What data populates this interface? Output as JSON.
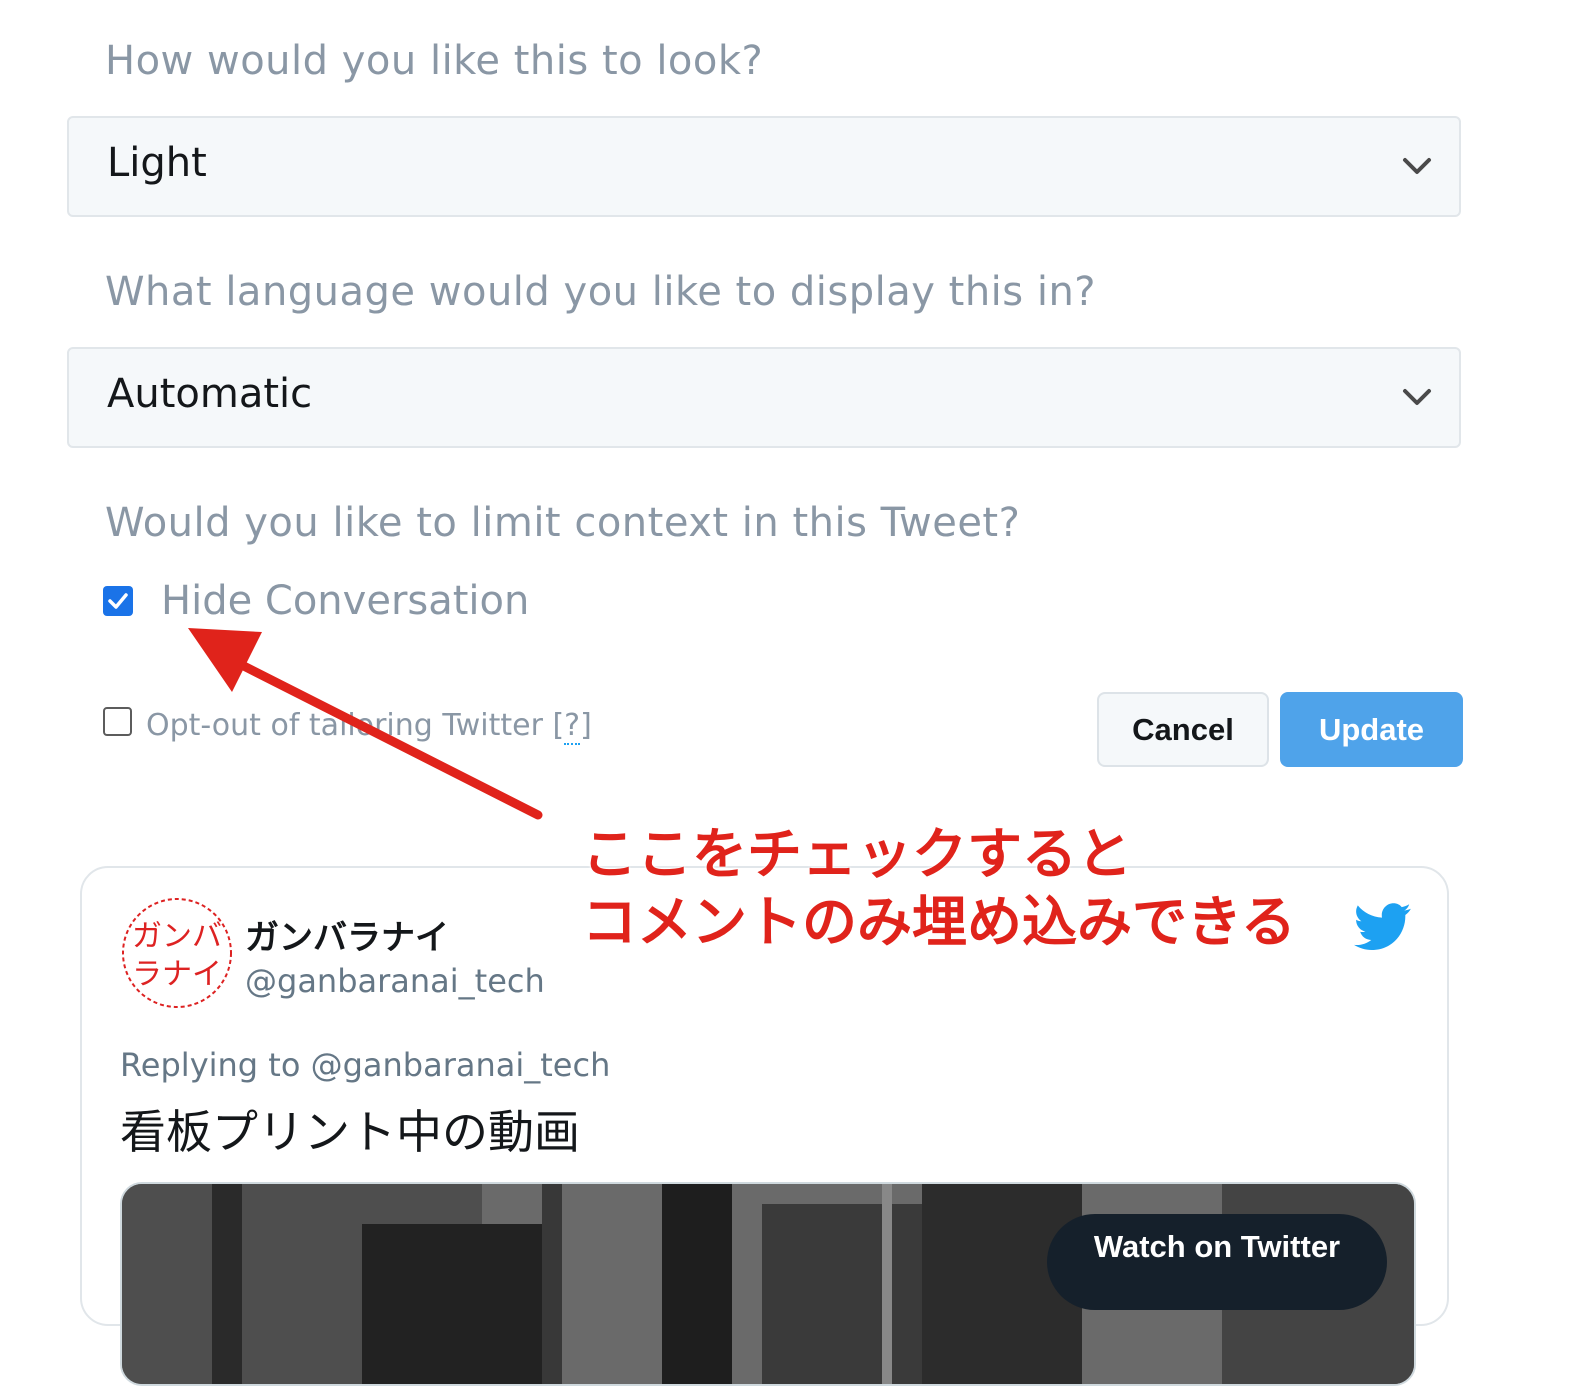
{
  "form": {
    "look_question": "How would you like this to look?",
    "look_value": "Light",
    "language_question": "What language would you like to display this in?",
    "language_value": "Automatic",
    "context_question": "Would you like to limit context in this Tweet?",
    "hide_conversation_label": "Hide Conversation",
    "hide_conversation_checked": true,
    "optout_label_prefix": "Opt-out of tailoring Twitter",
    "optout_help_open": "[",
    "optout_help_link": "?",
    "optout_help_close": "]",
    "optout_checked": false,
    "cancel_label": "Cancel",
    "update_label": "Update"
  },
  "annotation": {
    "line1": "ここをチェックすると",
    "line2": "コメントのみ埋め込みできる",
    "color": "#e0231b"
  },
  "tweet": {
    "avatar_text_line1": "ガンバ",
    "avatar_text_line2": "ラナイ",
    "display_name": "ガンバラナイ",
    "handle": "@ganbaranai_tech",
    "reply_prefix": "Replying to",
    "reply_mention": "@ganbaranai_tech",
    "text": "看板プリント中の動画",
    "watch_button": "Watch on Twitter",
    "brand_color": "#1da1f2"
  }
}
